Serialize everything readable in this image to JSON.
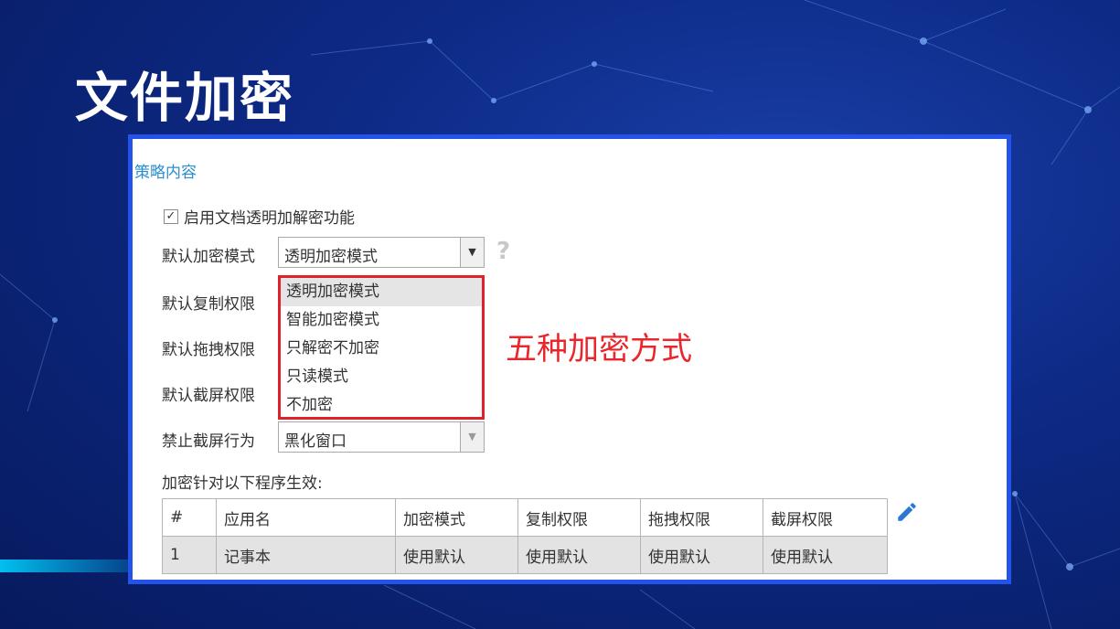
{
  "slide": {
    "title": "文件加密"
  },
  "panel": {
    "section_heading": "策略内容",
    "enable_checkbox": {
      "label": "启用文档透明加解密功能",
      "checked": true,
      "check_glyph": "✓"
    },
    "fields": [
      {
        "label": "默认加密模式",
        "value": "透明加密模式"
      },
      {
        "label": "默认复制权限"
      },
      {
        "label": "默认拖拽权限"
      },
      {
        "label": "默认截屏权限"
      },
      {
        "label": "禁止截屏行为",
        "value": "黑化窗口"
      }
    ],
    "help_icon": {
      "glyph": "?",
      "name": "question-mark-icon"
    },
    "dropdown_arrow_glyph": "▼",
    "encryption_modes": [
      "透明加密模式",
      "智能加密模式",
      "只解密不加密",
      "只读模式",
      "不加密"
    ],
    "selected_mode_index": 0,
    "annotation": "五种加密方式",
    "annotation_color": "#e8262c",
    "table_caption": "加密针对以下程序生效:",
    "table": {
      "columns": [
        "#",
        "应用名",
        "加密模式",
        "复制权限",
        "拖拽权限",
        "截屏权限"
      ],
      "rows": [
        [
          "1",
          "记事本",
          "使用默认",
          "使用默认",
          "使用默认",
          "使用默认"
        ]
      ]
    },
    "edit_icon": "pencil-icon",
    "accent_color": "#2353e8",
    "heading_color": "#2a8fd0"
  }
}
